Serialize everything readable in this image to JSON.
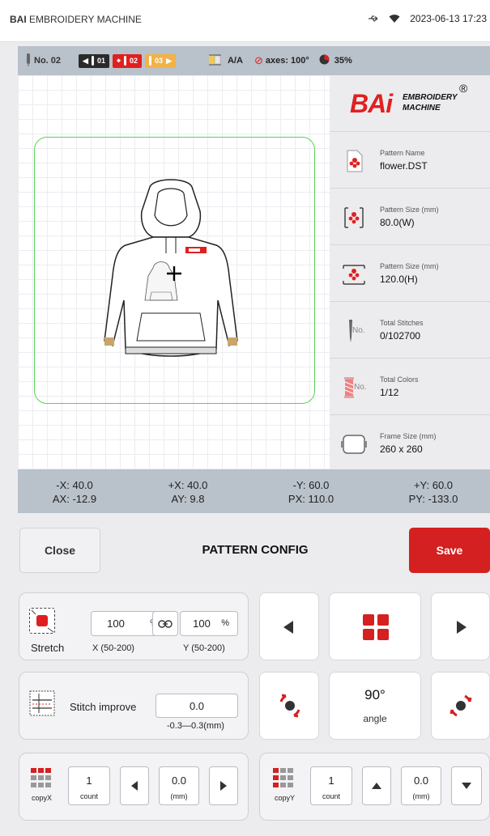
{
  "status_bar": {
    "brand": "BAI",
    "app_name": "EMBROIDERY MACHINE",
    "datetime": "2023-06-13 17:23",
    "icons": [
      "usb-icon",
      "wifi-icon"
    ]
  },
  "info_bar": {
    "needle_no": "No. 02",
    "chip_prev": "01",
    "chip_current": "02",
    "chip_next": "03",
    "mode": "A/A",
    "axes": "axes: 100°",
    "progress": "35%"
  },
  "side_panel": {
    "logo_text": "BAi",
    "logo_sub1": "EMBROIDERY",
    "logo_sub2": "MACHINE",
    "logo_reg": "®",
    "pattern_name_label": "Pattern Name",
    "pattern_name": "flower.DST",
    "width_label": "Pattern Size (mm)",
    "width_value": "80.0(W)",
    "height_label": "Pattern Size (mm)",
    "height_value": "120.0(H)",
    "stitches_label": "Total Stitches",
    "stitches_value": "0/102700",
    "stitches_icon_text": "No.",
    "colors_label": "Total Colors",
    "colors_value": "1/12",
    "colors_icon_text": "No.",
    "frame_label": "Frame Size (mm)",
    "frame_value": "260 x 260"
  },
  "coords": {
    "neg_x": "-X: 40.0",
    "pos_x": "+X: 40.0",
    "neg_y": "-Y: 60.0",
    "pos_y": "+Y: 60.0",
    "ax": "AX: -12.9",
    "ay": "AY: 9.8",
    "px": "PX: 110.0",
    "py": "PY: -133.0"
  },
  "header": {
    "close_label": "Close",
    "title": "PATTERN CONFIG",
    "save_label": "Save"
  },
  "stretch": {
    "label": "Stretch",
    "x_value": "100",
    "y_value": "100",
    "unit": "%",
    "x_range": "X (50-200)",
    "y_range": "Y (50-200)"
  },
  "stitch_improve": {
    "label": "Stitch improve",
    "value": "0.0",
    "range": "-0.3—0.3(mm)"
  },
  "angle": {
    "value": "90°",
    "label": "angle"
  },
  "copy_x": {
    "label": "copyX",
    "count": "1",
    "count_label": "count",
    "distance": "0.0",
    "unit": "(mm)"
  },
  "copy_y": {
    "label": "copyY",
    "count": "1",
    "count_label": "count",
    "distance": "0.0",
    "unit": "(mm)"
  },
  "colors": {
    "accent_red": "#d42020",
    "frame_green": "#5ad05a",
    "bar_grey": "#b9c1ca"
  }
}
